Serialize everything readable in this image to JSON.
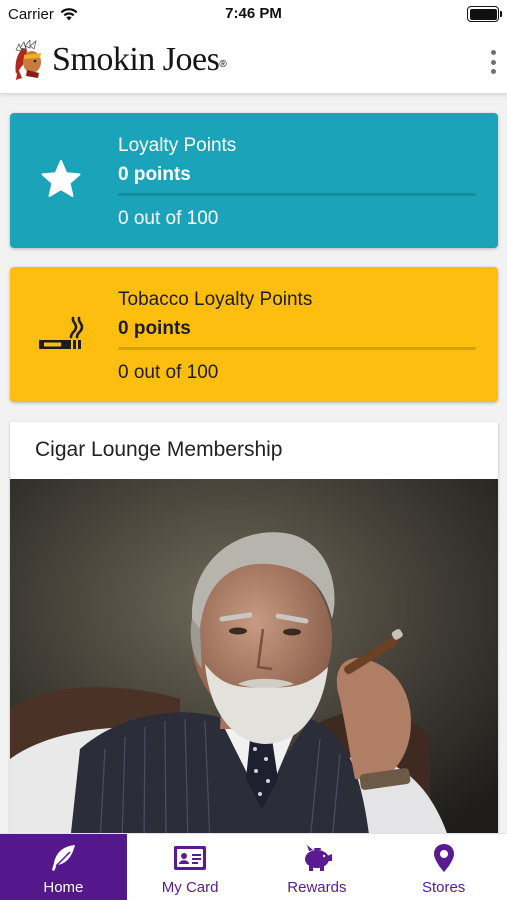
{
  "status_bar": {
    "carrier": "Carrier",
    "time": "7:46 PM"
  },
  "header": {
    "brand": "Smokin Joes",
    "reg_mark": "®",
    "menu_icon": "more-vertical-icon"
  },
  "loyalty_card": {
    "icon": "star-icon",
    "title": "Loyalty Points",
    "points": "0 points",
    "progress_text": "0 out of 100",
    "progress_fraction": 0
  },
  "tobacco_card": {
    "icon": "cigarette-icon",
    "title": "Tobacco Loyalty Points",
    "points": "0 points",
    "progress_text": "0 out of 100",
    "progress_fraction": 0
  },
  "membership": {
    "title": "Cigar Lounge Membership"
  },
  "tabs": [
    {
      "label": "Home",
      "icon": "feather-icon",
      "active": true
    },
    {
      "label": "My Card",
      "icon": "id-card-icon",
      "active": false
    },
    {
      "label": "Rewards",
      "icon": "piggy-bank-icon",
      "active": false
    },
    {
      "label": "Stores",
      "icon": "location-pin-icon",
      "active": false
    }
  ],
  "colors": {
    "loyalty": "#1ba4b9",
    "tobacco": "#fdbe0f",
    "accent": "#55178c"
  }
}
